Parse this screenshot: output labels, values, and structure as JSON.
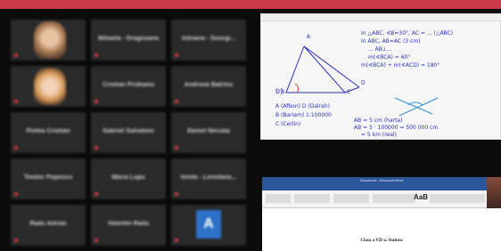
{
  "meeting": {
    "participants": [
      {
        "name": "",
        "type": "video",
        "style": "f1"
      },
      {
        "name": "Mihaela - Dragosana",
        "type": "name"
      },
      {
        "name": "Adriana - Georgi...",
        "type": "name"
      },
      {
        "name": "",
        "type": "video",
        "style": "f2"
      },
      {
        "name": "Cristian Pruteanu",
        "type": "name"
      },
      {
        "name": "Andreea Batrinu",
        "type": "name"
      },
      {
        "name": "Pintea Cristian",
        "type": "name"
      },
      {
        "name": "Gabriel Salvatore",
        "type": "name"
      },
      {
        "name": "Daniel Neculai",
        "type": "name"
      },
      {
        "name": "Teodor Popescu",
        "type": "name"
      },
      {
        "name": "Maria Lupu",
        "type": "name"
      },
      {
        "name": "Ionita - Loredana...",
        "type": "name"
      },
      {
        "name": "Radu Adrian",
        "type": "name"
      },
      {
        "name": "Valentin Radu",
        "type": "name"
      },
      {
        "name": "",
        "type": "avatar",
        "initial": "A"
      }
    ]
  },
  "whiteboard": {
    "lines": [
      "In △ABC, ∢B=30°, AC = ... (△ABC)",
      "In ABC, AB=AC (3 cm)",
      "... AB⊥... ",
      "m(∢BCA) = 60°",
      "m(∢BCA) + m(∢ACD) = 180°"
    ],
    "vertices": [
      "A",
      "B",
      "C",
      "D"
    ],
    "letter_b": "b)",
    "list": [
      "A (Afbon)   D (Dalrah)",
      "B (Bariam)   1:100000",
      "C (Cerlin)"
    ],
    "calc": [
      "AB = 5 cm (harta)",
      "AB = 5 · 100000 = 500 000 cm",
      "= 5 km (real)"
    ]
  },
  "document": {
    "title_bar": "Document - Microsoft Word",
    "ribbon_style": "AaB",
    "heading": "Clasa a VII-a. Statura"
  },
  "colors": {
    "topbar": "#c9394a",
    "pen": "#2a2fb8",
    "word_blue": "#2b579a"
  }
}
